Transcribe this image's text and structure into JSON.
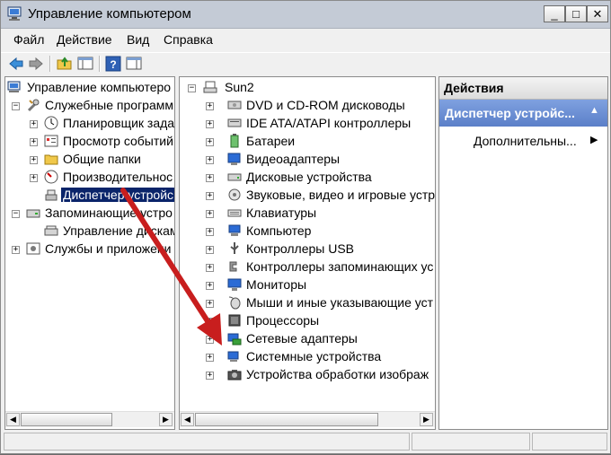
{
  "window": {
    "title": "Управление компьютером"
  },
  "title_buttons": {
    "minimize": "_",
    "maximize": "□",
    "close": "✕"
  },
  "menu": [
    "Файл",
    "Действие",
    "Вид",
    "Справка"
  ],
  "left_tree": [
    {
      "label": "Управление компьютеро",
      "icon": "computer-management-icon",
      "expander": ""
    },
    {
      "label": "Служебные программ",
      "icon": "tools-icon",
      "expander": "−"
    },
    {
      "label": "Планировщик задан",
      "icon": "clock-icon",
      "expander": "+"
    },
    {
      "label": "Просмотр событий",
      "icon": "event-viewer-icon",
      "expander": "+"
    },
    {
      "label": "Общие папки",
      "icon": "shared-folder-icon",
      "expander": "+"
    },
    {
      "label": "Производительнос",
      "icon": "performance-icon",
      "expander": "+"
    },
    {
      "label": "Диспетчер устройс",
      "icon": "device-manager-icon",
      "expander": ""
    },
    {
      "label": "Запоминающие устро",
      "icon": "storage-icon",
      "expander": "−"
    },
    {
      "label": "Управление дискам",
      "icon": "disk-management-icon",
      "expander": ""
    },
    {
      "label": "Службы и приложени",
      "icon": "services-icon",
      "expander": "+"
    }
  ],
  "device_tree": {
    "root": "Sun2",
    "items": [
      "DVD и CD-ROM дисководы",
      "IDE ATA/ATAPI контроллеры",
      "Батареи",
      "Видеоадаптеры",
      "Дисковые устройства",
      "Звуковые, видео и игровые устр",
      "Клавиатуры",
      "Компьютер",
      "Контроллеры USB",
      "Контроллеры запоминающих ус",
      "Мониторы",
      "Мыши и иные указывающие уст",
      "Процессоры",
      "Сетевые адаптеры",
      "Системные устройства",
      "Устройства обработки изображ"
    ]
  },
  "actions": {
    "header": "Действия",
    "section": "Диспетчер устройс...",
    "more": "Дополнительны..."
  },
  "colors": {
    "selection": "#0a246a",
    "actions_header": "#6d8fd3",
    "arrow": "#c81e1e"
  }
}
